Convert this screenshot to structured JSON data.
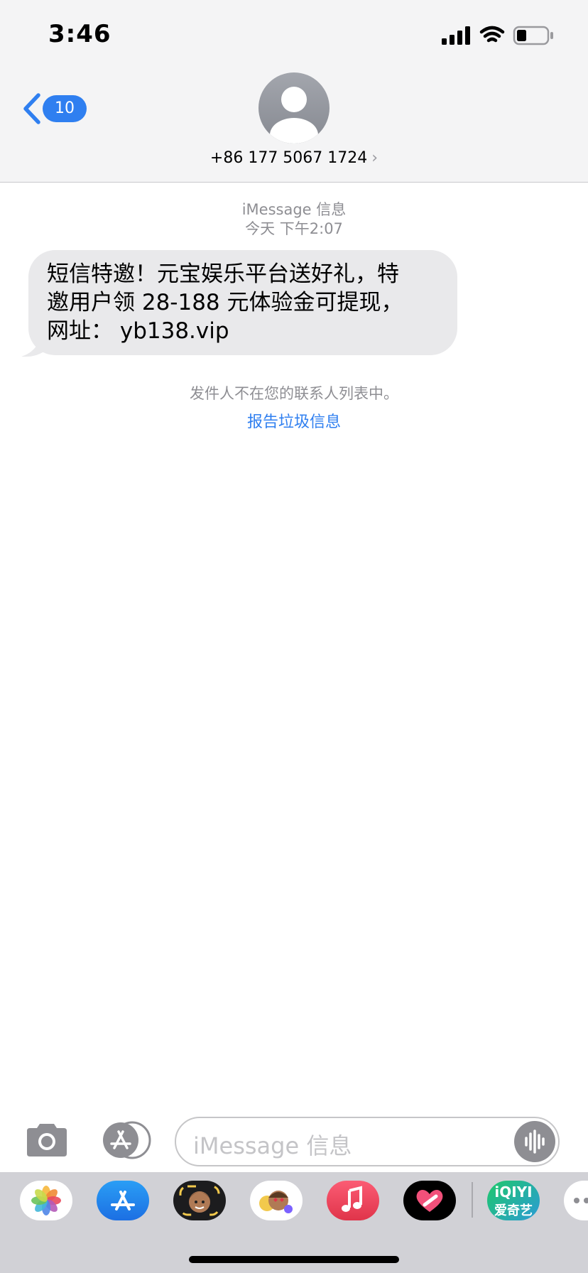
{
  "status_bar": {
    "time": "3:46"
  },
  "nav": {
    "back_count": "10",
    "contact": "+86 177 5067 1724",
    "contact_chevron": "›"
  },
  "thread": {
    "service": "iMessage 信息",
    "timestamp": "今天 下午2:07",
    "message": {
      "line1": "短信特邀！元宝娱乐平台送好礼，特",
      "line2": "邀用户领 28-188 元体验金可提现，",
      "line3": "网址：  yb138.vip"
    },
    "notice": "发件人不在您的联系人列表中。",
    "report_link": "报告垃圾信息"
  },
  "compose": {
    "placeholder": "iMessage 信息"
  },
  "app_tray": {
    "apps": [
      "photos-icon",
      "app-store-icon",
      "memoji-icon",
      "animoji-stickers-icon",
      "music-icon",
      "digital-touch-icon",
      "iqiyi-icon",
      "more-icon"
    ],
    "iqiyi_line1": "iQIYI",
    "iqiyi_line2": "爱奇艺"
  },
  "colors": {
    "accent": "#2f7ff0",
    "bubble": "#e9e9eb",
    "header": "#f4f4f5",
    "tray": "#d1d1d6"
  }
}
